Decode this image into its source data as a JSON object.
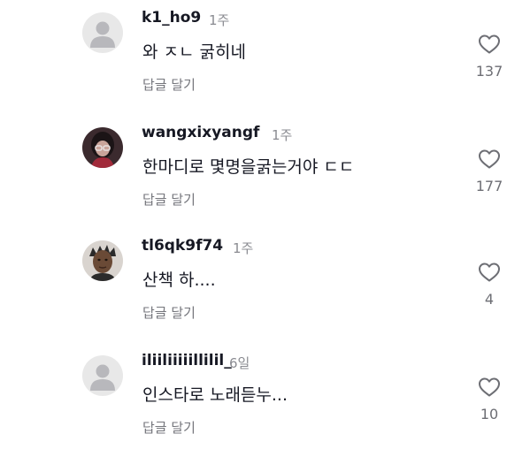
{
  "comments": [
    {
      "username": "k1_ho9",
      "time": "1주",
      "text": "와 ㅈㄴ 굵히네",
      "reply_label": "답글 달기",
      "like_count": "137",
      "avatar": "default-avatar-icon"
    },
    {
      "username": "wangxixyangf",
      "time": "1주",
      "text": "한마디로 몇명을굵는거야 ㄷㄷ",
      "reply_label": "답글 달기",
      "like_count": "177",
      "avatar": "photo-avatar"
    },
    {
      "username": "tl6qk9f74",
      "time": "1주",
      "text": "산책 하....",
      "reply_label": "답글 달기",
      "like_count": "4",
      "avatar": "photo-avatar"
    },
    {
      "username": "iliiliiiiillilil_",
      "time": "6일",
      "text": "인스타로 노래듣누...",
      "reply_label": "답글 달기",
      "like_count": "10",
      "avatar": "default-avatar-icon"
    }
  ],
  "colors": {
    "username": "#161823",
    "time": "#8a8b91",
    "reply": "#75767c",
    "like_count": "#6d6e74",
    "default_avatar_bg": "#e8e8e8",
    "default_avatar_fg": "#b8b8bc"
  }
}
